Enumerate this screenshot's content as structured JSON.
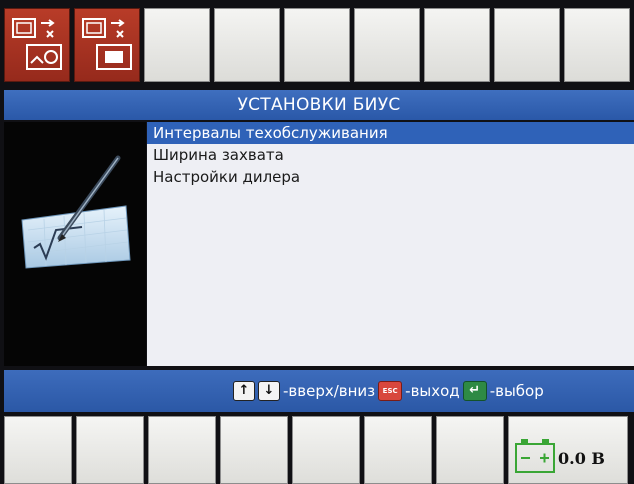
{
  "title_bar": {
    "title": "УСТАНОВКИ БИУС"
  },
  "menu": {
    "items": [
      {
        "label": "Интервалы техобслуживания",
        "selected": true
      },
      {
        "label": "Ширина захвата",
        "selected": false
      },
      {
        "label": "Настройки дилера",
        "selected": false
      }
    ]
  },
  "help_bar": {
    "updown_text": "-вверх/вниз",
    "esc_key_label": "ESC",
    "exit_text": "-выход",
    "select_text": "-выбор"
  },
  "status": {
    "voltage": "0.0 В"
  },
  "icons": {
    "top_key_1": "display-swap-icon",
    "top_key_2": "display-toggle-icon",
    "panel": "settings-pen-icon",
    "battery": "battery-icon"
  },
  "colors": {
    "accent_blue": "#2f62b8",
    "active_key_red": "#a8321f",
    "battery_green": "#3aa635"
  }
}
